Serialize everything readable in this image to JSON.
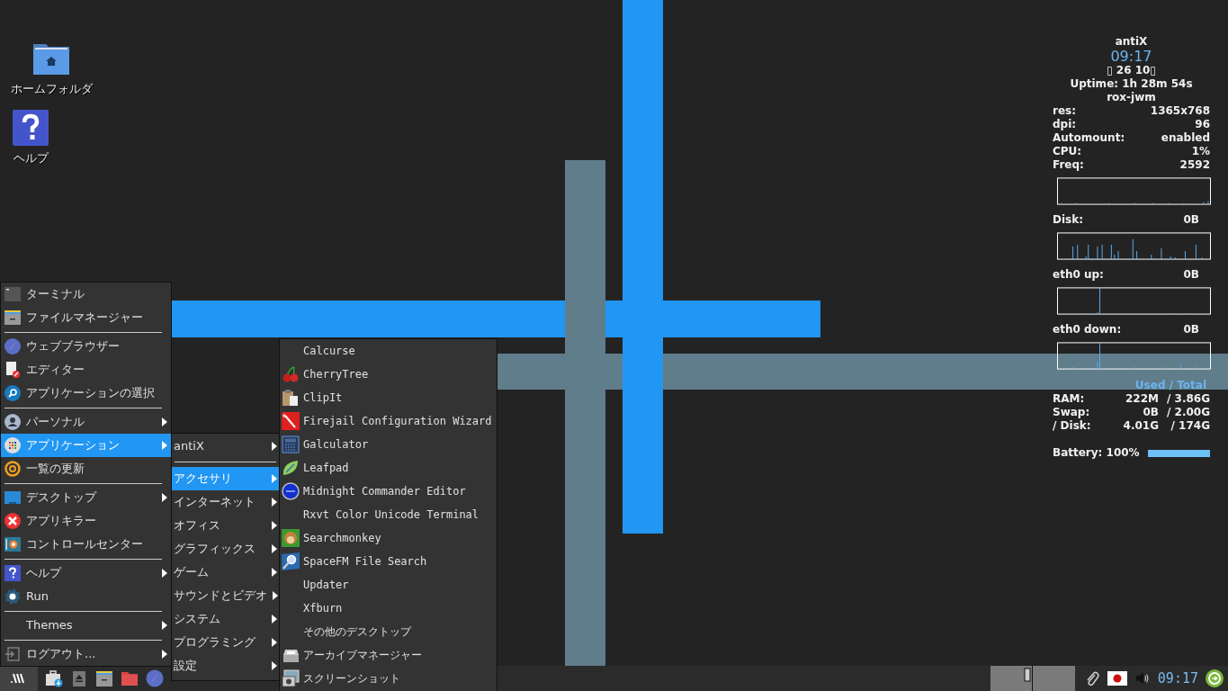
{
  "desktop_icons": [
    {
      "label": "ホームフォルダ"
    },
    {
      "label": "ヘルプ"
    }
  ],
  "main_menu": {
    "items": [
      {
        "label": "ターミナル",
        "submenu": false,
        "selected": false,
        "separator_after": false
      },
      {
        "label": "ファイルマネージャー",
        "submenu": false,
        "selected": false,
        "separator_after": true
      },
      {
        "label": "ウェブブラウザー",
        "submenu": false,
        "selected": false,
        "separator_after": false
      },
      {
        "label": "エディター",
        "submenu": false,
        "selected": false,
        "separator_after": false
      },
      {
        "label": "アプリケーションの選択",
        "submenu": false,
        "selected": false,
        "separator_after": true
      },
      {
        "label": "パーソナル",
        "submenu": true,
        "selected": false,
        "separator_after": false
      },
      {
        "label": "アプリケーション",
        "submenu": true,
        "selected": true,
        "separator_after": false
      },
      {
        "label": "一覧の更新",
        "submenu": false,
        "selected": false,
        "separator_after": true
      },
      {
        "label": "デスクトップ",
        "submenu": true,
        "selected": false,
        "separator_after": false
      },
      {
        "label": "アプリキラー",
        "submenu": false,
        "selected": false,
        "separator_after": false
      },
      {
        "label": "コントロールセンター",
        "submenu": false,
        "selected": false,
        "separator_after": true
      },
      {
        "label": "ヘルプ",
        "submenu": true,
        "selected": false,
        "separator_after": false
      },
      {
        "label": "Run",
        "submenu": false,
        "selected": false,
        "separator_after": true
      },
      {
        "label": "Themes",
        "submenu": true,
        "selected": false,
        "separator_after": true
      },
      {
        "label": "ログアウト...",
        "submenu": true,
        "selected": false,
        "separator_after": false
      }
    ]
  },
  "applications_menu": {
    "items": [
      {
        "label": "antiX",
        "selected": false,
        "separator_after": true
      },
      {
        "label": "アクセサリ",
        "selected": true,
        "separator_after": false
      },
      {
        "label": "インターネット",
        "selected": false,
        "separator_after": false
      },
      {
        "label": "オフィス",
        "selected": false,
        "separator_after": false
      },
      {
        "label": "グラフィックス",
        "selected": false,
        "separator_after": false
      },
      {
        "label": "ゲーム",
        "selected": false,
        "separator_after": false
      },
      {
        "label": "サウンドとビデオ",
        "selected": false,
        "separator_after": false
      },
      {
        "label": "システム",
        "selected": false,
        "separator_after": false
      },
      {
        "label": "プログラミング",
        "selected": false,
        "separator_after": false
      },
      {
        "label": "設定",
        "selected": false,
        "separator_after": false
      }
    ]
  },
  "accessories_menu": {
    "items": [
      {
        "label": "Calcurse"
      },
      {
        "label": "CherryTree"
      },
      {
        "label": "ClipIt"
      },
      {
        "label": "Firejail Configuration Wizard"
      },
      {
        "label": "Galculator"
      },
      {
        "label": "Leafpad"
      },
      {
        "label": "Midnight Commander Editor"
      },
      {
        "label": "Rxvt Color Unicode Terminal"
      },
      {
        "label": "Searchmonkey"
      },
      {
        "label": "SpaceFM File Search"
      },
      {
        "label": "Updater"
      },
      {
        "label": "Xfburn"
      },
      {
        "label": "その他のデスクトップ"
      },
      {
        "label": "アーカイブマネージャー"
      },
      {
        "label": "スクリーンショット"
      }
    ]
  },
  "conky": {
    "hostname": "antiX",
    "time": "09:17",
    "date": "▯ 26 10▯",
    "uptime": "Uptime: 1h 28m 54s",
    "window_manager": "rox-jwm",
    "stats": [
      {
        "label": "res:",
        "value": "1365x768"
      },
      {
        "label": "dpi:",
        "value": "96"
      },
      {
        "label": "Automount:",
        "value": "enabled"
      },
      {
        "label": "CPU:",
        "value": "1%"
      },
      {
        "label": "Freq:",
        "value": "2592"
      }
    ],
    "graphs": [
      {
        "label": "Disk:",
        "value": "0B"
      },
      {
        "label": "eth0 up:",
        "value": "0B"
      },
      {
        "label": "eth0 down:",
        "value": "0B"
      }
    ],
    "memory_header": "Used / Total",
    "memory": [
      {
        "label": "RAM:",
        "used": "222M",
        "total": "/ 3.86G"
      },
      {
        "label": "Swap:",
        "used": "0B",
        "total": "/ 2.00G"
      },
      {
        "label": "/ Disk:",
        "used": "4.01G",
        "total": "/ 174G"
      }
    ],
    "battery": {
      "label": "Battery: 100%",
      "level": 1.0
    }
  },
  "taskbar": {
    "clock": "09:17"
  }
}
